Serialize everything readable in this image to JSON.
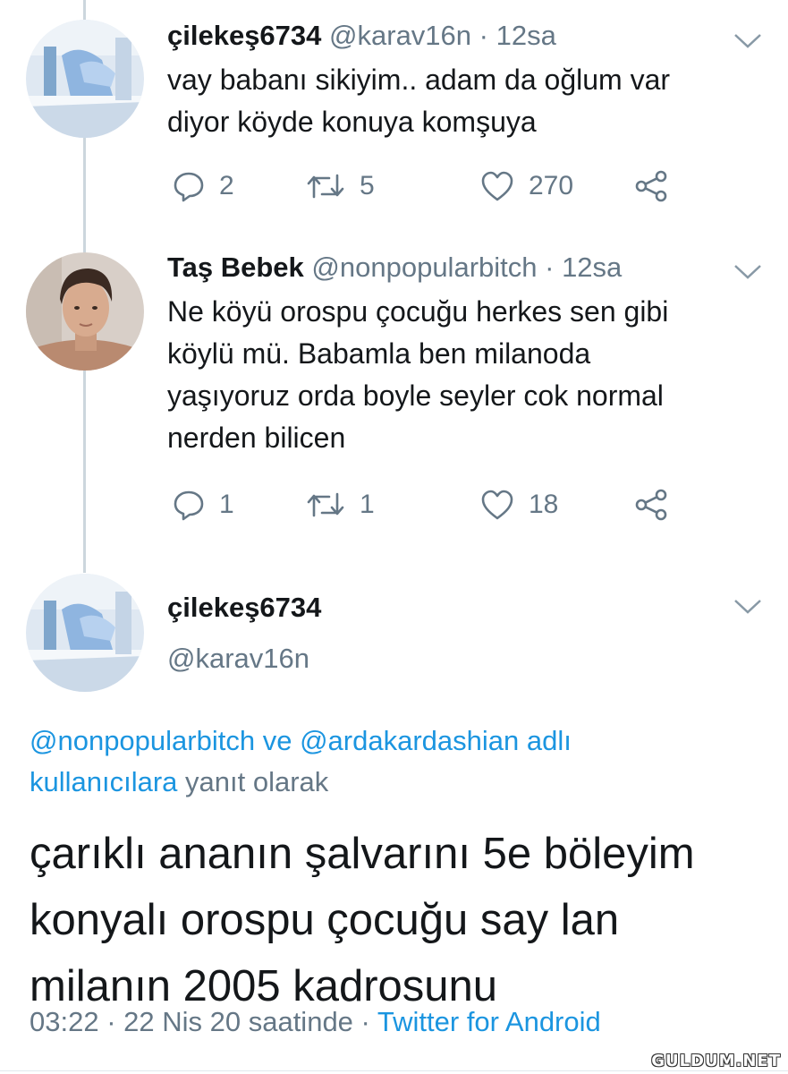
{
  "tweets": [
    {
      "display_name": "çilekeş6734",
      "handle": "@karav16n",
      "separator": " · ",
      "time": "12sa",
      "text_lines": [
        "vay babanı sikiyim.. adam da oğlum var",
        "diyor köyde konuya komşuya"
      ],
      "reply_count": "2",
      "retweet_count": "5",
      "like_count": "270"
    },
    {
      "display_name": "Taş Bebek",
      "handle": "@nonpopularbitch",
      "separator": " · ",
      "time": "12sa",
      "text_lines": [
        "Ne köyü orospu çocuğu herkes sen gibi",
        "köylü mü. Babamla ben milanoda",
        "yaşıyoruz orda boyle seyler cok normal",
        "nerden bilicen"
      ],
      "reply_count": "1",
      "retweet_count": "1",
      "like_count": "18"
    }
  ],
  "main_tweet": {
    "display_name": "çilekeş6734",
    "handle": "@karav16n",
    "reply_to": {
      "mention_1": "@nonpopularbitch",
      "connector": " ve ",
      "mention_2": "@ardakardashian adlı",
      "mention_3": "kullanıcılara",
      "suffix": " yanıt olarak"
    },
    "text_lines": [
      "çarıklı ananın şalvarını 5e böleyim",
      "konyalı orospu çocuğu say lan",
      "milanın 2005 kadrosunu"
    ],
    "time": "03:22",
    "sep": " · ",
    "date": "22 Nis 20 saatinde",
    "source": "Twitter for Android"
  },
  "watermark": "GULDUM.NET",
  "colors": {
    "link": "#1b95e0",
    "muted": "#657786",
    "text": "#14171a",
    "thread_line": "#ccd6dd"
  },
  "icons": [
    "reply-icon",
    "retweet-icon",
    "like-icon",
    "share-icon",
    "chevron-down-icon"
  ]
}
